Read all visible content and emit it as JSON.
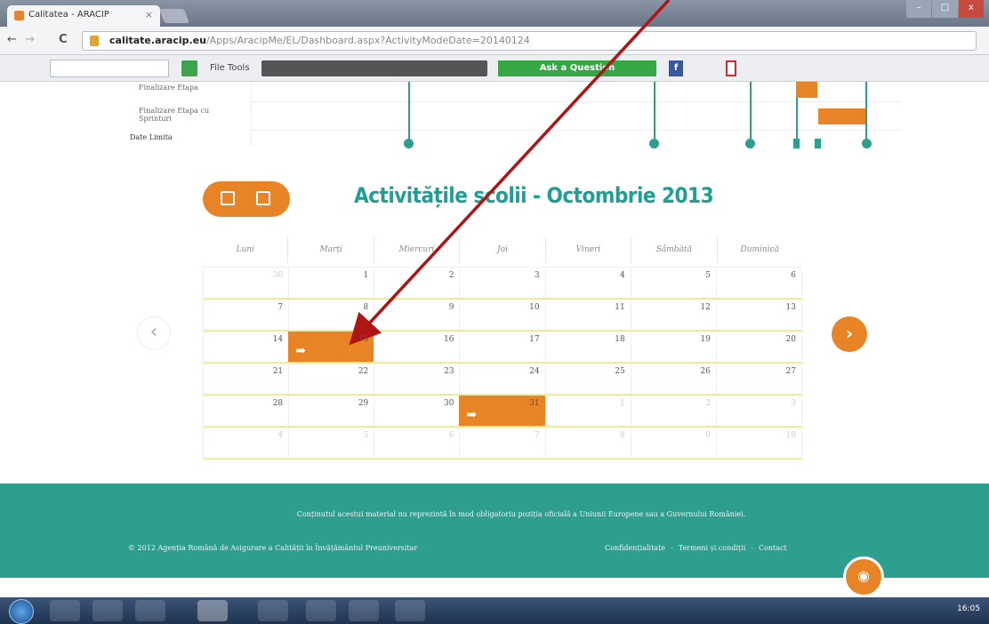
{
  "browser": {
    "tab_title": "Calitatea - ARACIP",
    "tab_close": "×",
    "url_domain": "calitate.aracip.eu",
    "url_path": "/Apps/AracipMe/EL/Dashboard.aspx?ActivityModeDate=20140124",
    "nav_back": "←",
    "nav_forward": "→",
    "nav_reload": "C",
    "win_min": "–",
    "win_max": "□",
    "win_close": "x"
  },
  "toolbar": {
    "file_tools": "File Tools",
    "tools": "Tools",
    "ask": "Ask a Question",
    "fb": "f"
  },
  "timeline": {
    "labels": [
      "Finalizare Etapa",
      "Finalizare Etapa cu Sprinturi",
      "Date Limita"
    ]
  },
  "calendar": {
    "title": "Activitățile școlii - Octombrie 2013",
    "weekdays": [
      "Luni",
      "Marți",
      "Miercuri",
      "Joi",
      "Vineri",
      "Sâmbătă",
      "Duminică"
    ],
    "weeks": [
      [
        "30",
        "1",
        "2",
        "3",
        "4",
        "5",
        "6"
      ],
      [
        "7",
        "8",
        "9",
        "10",
        "11",
        "12",
        "13"
      ],
      [
        "14",
        "15",
        "16",
        "17",
        "18",
        "19",
        "20"
      ],
      [
        "21",
        "22",
        "23",
        "24",
        "25",
        "26",
        "27"
      ],
      [
        "28",
        "29",
        "30",
        "31",
        "1",
        "2",
        "3"
      ],
      [
        "4",
        "5",
        "6",
        "7",
        "8",
        "9",
        "10"
      ]
    ],
    "prev": "‹",
    "next": "›",
    "event_arrow": "➡",
    "events": [
      {
        "date": "15 Octombrie 2013"
      },
      {
        "date": "31 Octombrie 2013"
      }
    ]
  },
  "footer": {
    "disclaimer": "Conținutul acestui material nu reprezintă în mod obligatoriu poziția oficială a Uniunii Europene sau a Guvernului României.",
    "copyright": "© 2012 Agenția Română de Asigurare a Calității în Învățământul Preuniversitar",
    "links": [
      "Confidențialitate",
      "Termeni și condiții",
      "Contact"
    ],
    "link_sep": "-"
  },
  "taskbar": {
    "clock": "16:05"
  },
  "colors": {
    "accent": "#e88426",
    "teal": "#2e9e8e",
    "annotation": "#b01515"
  }
}
